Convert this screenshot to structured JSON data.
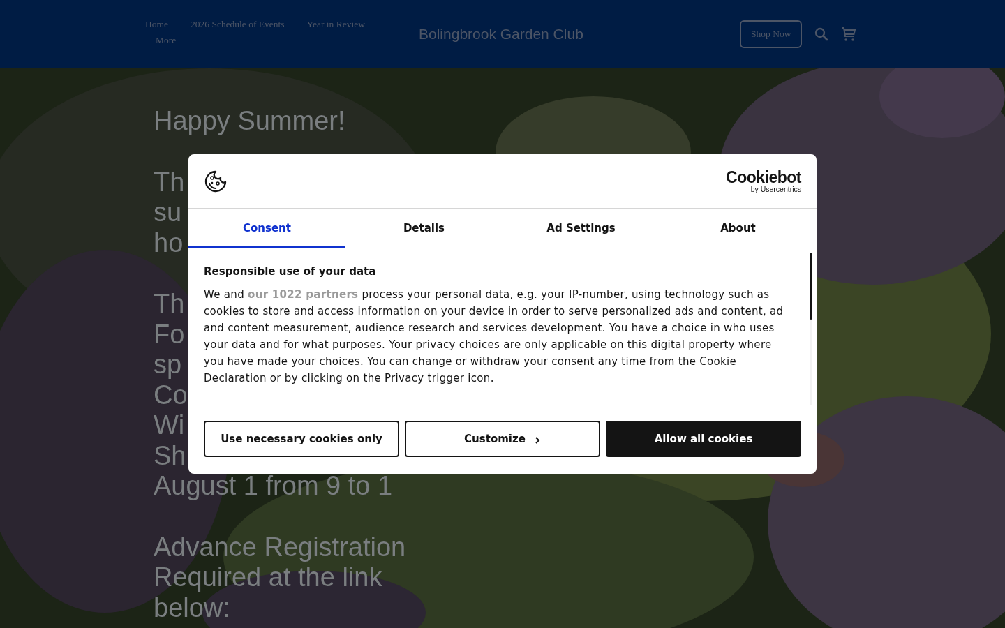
{
  "header": {
    "nav": [
      {
        "label": "Home"
      },
      {
        "label": "2026 Schedule of Events"
      },
      {
        "label": "Year in Review"
      },
      {
        "label": "More"
      }
    ],
    "site_title": "Bolingbrook Garden Club",
    "shop_button": "Shop Now"
  },
  "content": {
    "paragraphs": [
      [
        "Happy Summer!"
      ],
      [
        "Th",
        "su",
        "ho"
      ],
      [
        "Th",
        "Fo",
        "sp",
        "Co",
        "Wi",
        "Sh",
        "August 1 from 9 to 1"
      ],
      [
        "Advance Registration",
        "Required at the link",
        "below:"
      ]
    ]
  },
  "cookie_dialog": {
    "logo": {
      "name": "Cookiebot",
      "byline": "by Usercentrics"
    },
    "tabs": [
      {
        "label": "Consent",
        "selected": true
      },
      {
        "label": "Details",
        "selected": false
      },
      {
        "label": "Ad Settings",
        "selected": false
      },
      {
        "label": "About",
        "selected": false
      }
    ],
    "heading": "Responsible use of your data",
    "text_before": "We and",
    "link": "our 1022 partners",
    "text_after": "process your personal data, e.g. your IP-number, using technology such as cookies to store and access information on your device in order to serve personalized ads and content, ad and content measurement, audience research and services development. You have a choice in who uses your data and for what purposes. Your privacy choices are only applicable on this digital property where you have made your choices. You can change or withdraw your consent any time from the Cookie Declaration or by clicking on the Privacy trigger icon.",
    "buttons": [
      {
        "label": "Use necessary cookies only",
        "kind": "outline"
      },
      {
        "label": "Customize",
        "kind": "chevron"
      },
      {
        "label": "Allow all cookies",
        "kind": "filled"
      }
    ]
  }
}
